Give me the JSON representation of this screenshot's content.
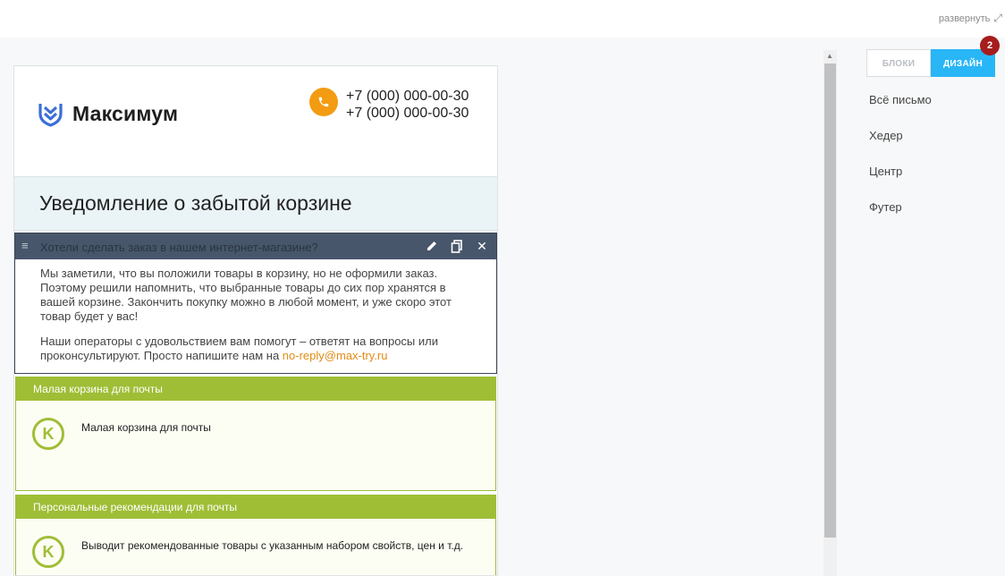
{
  "topbar": {
    "expand_label": "развернуть"
  },
  "email": {
    "logo_text": "Максимум",
    "phones": [
      "+7 (000) 000-00-30",
      "+7 (000) 000-00-30"
    ],
    "banner_title": "Уведомление о забытой корзине",
    "text_block": {
      "caption": "Хотели сделать заказ в нашем интернет-магазине?",
      "paragraph1": "Мы заметили, что вы положили товары в корзину, но не оформили заказ. Поэтому решили напомнить, что выбранные товары до сих пор хранятся в вашей корзине. Закончить покупку можно в любой момент, и уже скоро этот товар будет у вас!",
      "paragraph2_prefix": "Наши операторы с удовольствием вам помогут – ответят на вопросы или проконсультируют. Просто напишите нам на ",
      "email_link": "no-reply@max-try.ru"
    },
    "widgets": [
      {
        "title": "Малая корзина для почты",
        "badge": "K",
        "text": "Малая корзина для почты"
      },
      {
        "title": "Персональные рекомендации для почты",
        "badge": "K",
        "text": "Выводит рекомендованные товары с указанным набором свойств, цен и т.д."
      }
    ]
  },
  "panel": {
    "tabs": [
      {
        "label": "БЛОКИ"
      },
      {
        "label": "ДИЗАЙН"
      }
    ],
    "notification_count": "2",
    "menu": [
      {
        "label": "Всё письмо"
      },
      {
        "label": "Хедер"
      },
      {
        "label": "Центр"
      },
      {
        "label": "Футер"
      }
    ]
  },
  "colors": {
    "accent": "#29b6f6",
    "widget_green": "#9fbe36",
    "phone_orange": "#f39c12",
    "toolbar": "#47566a",
    "badge_red": "#a71c1c"
  },
  "icons": [
    "expand-icon",
    "logo-shield-icon",
    "phone-icon",
    "drag-handle-icon",
    "edit-icon",
    "copy-icon",
    "close-icon",
    "scroll-up-arrow-icon"
  ]
}
